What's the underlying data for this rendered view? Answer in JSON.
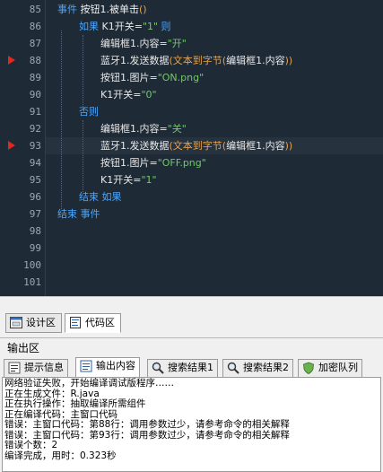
{
  "editor": {
    "breakpoint_lines": [
      88,
      93
    ],
    "lines": [
      {
        "num": "85",
        "indent": 0,
        "tokens": [
          [
            "kw",
            "事件 "
          ],
          [
            "ev",
            "按钮1.被单击"
          ],
          [
            "fn",
            "()"
          ]
        ]
      },
      {
        "num": "86",
        "indent": 1,
        "tokens": [
          [
            "kw",
            "如果 "
          ],
          [
            "txt",
            "K1开关"
          ],
          [
            "txt",
            "="
          ],
          [
            "str",
            "\"1\""
          ],
          [
            "kw",
            " 则"
          ]
        ]
      },
      {
        "num": "87",
        "indent": 2,
        "tokens": [
          [
            "txt",
            "编辑框1.内容"
          ],
          [
            "txt",
            "="
          ],
          [
            "str",
            "\"开\""
          ]
        ]
      },
      {
        "num": "88",
        "indent": 2,
        "tokens": [
          [
            "txt",
            "蓝牙1.发送数据"
          ],
          [
            "fn",
            "("
          ],
          [
            "fn",
            "文本到字节"
          ],
          [
            "fn",
            "("
          ],
          [
            "txt",
            "编辑框1.内容"
          ],
          [
            "fn",
            "))"
          ]
        ]
      },
      {
        "num": "89",
        "indent": 2,
        "tokens": [
          [
            "txt",
            "按钮1.图片"
          ],
          [
            "txt",
            "="
          ],
          [
            "str",
            "\"ON.png\""
          ]
        ]
      },
      {
        "num": "90",
        "indent": 2,
        "tokens": [
          [
            "txt",
            "K1开关"
          ],
          [
            "txt",
            "="
          ],
          [
            "str",
            "\"0\""
          ]
        ]
      },
      {
        "num": "91",
        "indent": 1,
        "tokens": [
          [
            "kw",
            "否则"
          ]
        ]
      },
      {
        "num": "92",
        "indent": 2,
        "tokens": [
          [
            "txt",
            "编辑框1.内容"
          ],
          [
            "txt",
            "="
          ],
          [
            "str",
            "\"关\""
          ]
        ]
      },
      {
        "num": "93",
        "indent": 2,
        "tokens": [
          [
            "txt",
            "蓝牙1.发送数据"
          ],
          [
            "fn",
            "("
          ],
          [
            "fn",
            "文本到字节"
          ],
          [
            "fn",
            "("
          ],
          [
            "txt",
            "编辑框1.内容"
          ],
          [
            "fn",
            "))"
          ]
        ]
      },
      {
        "num": "94",
        "indent": 2,
        "tokens": [
          [
            "txt",
            "按钮1.图片"
          ],
          [
            "txt",
            "="
          ],
          [
            "str",
            "\"OFF.png\""
          ]
        ]
      },
      {
        "num": "95",
        "indent": 2,
        "tokens": [
          [
            "txt",
            "K1开关"
          ],
          [
            "txt",
            "="
          ],
          [
            "str",
            "\"1\""
          ]
        ]
      },
      {
        "num": "96",
        "indent": 1,
        "tokens": [
          [
            "kw",
            "结束 如果"
          ]
        ]
      },
      {
        "num": "97",
        "indent": 0,
        "tokens": [
          [
            "kw",
            "结束 事件"
          ]
        ]
      },
      {
        "num": "98",
        "indent": 0,
        "tokens": []
      },
      {
        "num": "99",
        "indent": 0,
        "tokens": []
      },
      {
        "num": "100",
        "indent": 0,
        "tokens": []
      },
      {
        "num": "101",
        "indent": 0,
        "tokens": []
      }
    ],
    "highlight_line": "93"
  },
  "editor_tabs": {
    "design": "设计区",
    "code": "代码区"
  },
  "output": {
    "title": "输出区",
    "tabs": {
      "hints": "提示信息",
      "output": "输出内容",
      "search1": "搜索结果1",
      "search2": "搜索结果2",
      "queue": "加密队列"
    },
    "lines": [
      "网络验证失败，开始编译调试版程序……",
      "正在生成文件：R.java",
      "正在执行操作：抽取编译所需组件",
      "正在编译代码：主窗口代码",
      "错误：主窗口代码：第88行：调用参数过少，请参考命令的相关解释",
      "错误：主窗口代码：第93行：调用参数过少，请参考命令的相关解释",
      "错误个数：2",
      "编译完成，用时：0.323秒"
    ]
  },
  "colors": {
    "editor_bg": "#1e2a36",
    "keyword": "#4aa6ff",
    "string": "#74c86b",
    "function": "#e8a14a",
    "breakpoint": "#e0281c"
  }
}
